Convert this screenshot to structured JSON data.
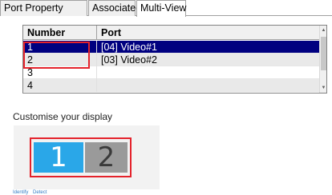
{
  "tabs": [
    {
      "label": "Port Property",
      "active": false
    },
    {
      "label": "Associated Link",
      "active": false
    },
    {
      "label": "Multi-View",
      "active": true
    }
  ],
  "table": {
    "headers": [
      "Number",
      "Port"
    ],
    "rows": [
      {
        "number": "1",
        "port": "[04] Video#1",
        "selected": true
      },
      {
        "number": "2",
        "port": "[03] Video#2",
        "selected": false
      },
      {
        "number": "3",
        "port": "",
        "selected": false
      },
      {
        "number": "4",
        "port": "",
        "selected": false
      }
    ]
  },
  "display": {
    "caption": "Customise your display",
    "monitors": [
      {
        "label": "1",
        "color": "#2aa7e8"
      },
      {
        "label": "2",
        "color": "#9a9a9a"
      }
    ],
    "links": [
      "Identify",
      "Detect"
    ]
  },
  "colors": {
    "selection": "#000080",
    "highlight_box": "#e4222b"
  }
}
